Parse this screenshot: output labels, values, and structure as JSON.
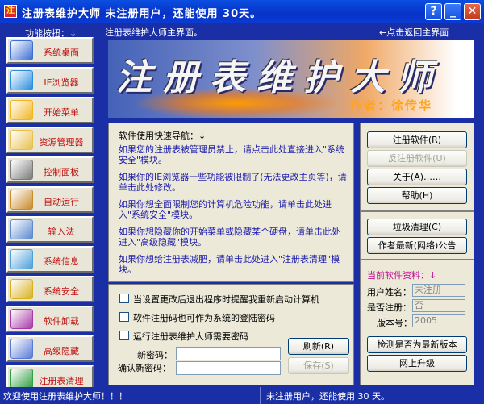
{
  "window": {
    "title": "注册表维护大师 未注册用户，还能使用 30天。",
    "help": "?",
    "minimize": "_",
    "close": "✕",
    "icon_glyph": "注"
  },
  "header": {
    "func_label": "功能按扭：↓",
    "subtitle": "注册表维护大师主界面。",
    "return_link": "←点击返回主界面"
  },
  "banner": {
    "title": "注册表维护大师",
    "author": "作者：徐传华"
  },
  "sidebar": {
    "items": [
      {
        "label": "系统桌面",
        "icon": "desktop-icon",
        "color": "#3b6fd4"
      },
      {
        "label": "IE浏览器",
        "icon": "ie-icon",
        "color": "#2a8ee0"
      },
      {
        "label": "开始菜单",
        "icon": "start-menu-icon",
        "color": "#f2b51c"
      },
      {
        "label": "资源管理器",
        "icon": "explorer-icon",
        "color": "#e8c04a"
      },
      {
        "label": "控制面板",
        "icon": "tools-icon",
        "color": "#7a7a7a"
      },
      {
        "label": "自动运行",
        "icon": "gear-icon",
        "color": "#c88a2a"
      },
      {
        "label": "输入法",
        "icon": "keyboard-icon",
        "color": "#5a8ad0"
      },
      {
        "label": "系统信息",
        "icon": "info-icon",
        "color": "#4aa0d8"
      },
      {
        "label": "系统安全",
        "icon": "key-icon",
        "color": "#d8b020"
      },
      {
        "label": "软件卸载",
        "icon": "uninstall-icon",
        "color": "#a83aa8"
      },
      {
        "label": "高级隐藏",
        "icon": "hide-icon",
        "color": "#5a7ad8"
      },
      {
        "label": "注册表清理",
        "icon": "registry-icon",
        "color": "#30a040"
      }
    ]
  },
  "nav": {
    "heading": "软件使用快速导航：↓",
    "items": [
      "如果您的注册表被管理员禁止，请点击此处直接进入\"系统安全\"模块。",
      "如果你的IE浏览器一些功能被限制了(无法更改主页等)，请单击此处修改。",
      "如果你想全面限制您的计算机危险功能，请单击此处进入\"系统安全\"模块。",
      "如果你想隐藏你的开始菜单或隐藏某个硬盘，请单击此处进入\"高级隐藏\"模块。",
      "如果你想给注册表减肥，请单击此处进入\"注册表清理\"模块。"
    ]
  },
  "options": {
    "restart_prompt": "当设置更改后退出程序时提醒我重新启动计算机",
    "serial_as_login": "软件注册码也可作为系统的登陆密码",
    "require_password": "运行注册表维护大师需要密码",
    "new_password_label": "新密码：",
    "confirm_password_label": "确认新密码：",
    "refresh": "刷新(R)",
    "save": "保存(S)"
  },
  "actions": {
    "register": "注册软件(R)",
    "unregister": "反注册软件(U)",
    "about": "关于(A)……",
    "help": "帮助(H)",
    "cleanup": "垃圾清理(C)",
    "announcement": "作者最新(网络)公告"
  },
  "info": {
    "heading": "当前软件资料：↓",
    "username_label": "用户姓名：",
    "username_value": "未注册",
    "registered_label": "是否注册：",
    "registered_value": "否",
    "version_label": "版本号：",
    "version_value": "2005",
    "check_update": "检测是否为最新版本",
    "online_upgrade": "网上升级"
  },
  "status": {
    "left": "欢迎使用注册表维护大师！！！",
    "right": "未注册用户，还能使用 30 天。"
  }
}
